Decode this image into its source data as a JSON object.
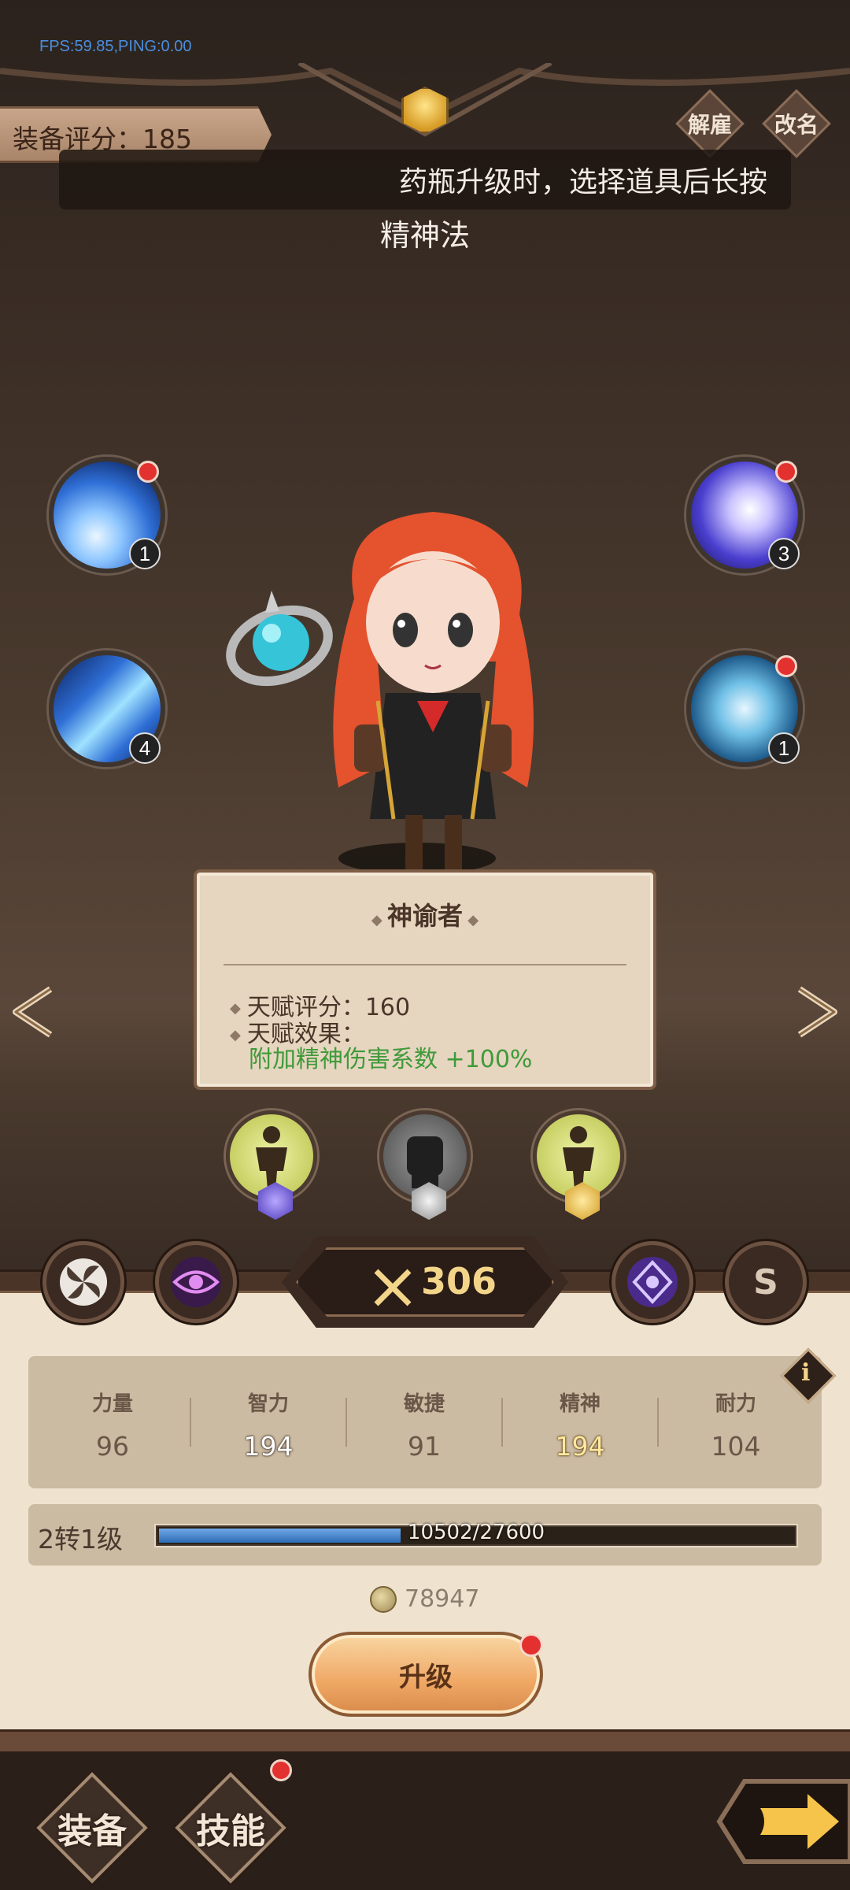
{
  "debug": {
    "fps_text": "FPS:59.85,PING:0.00"
  },
  "header": {
    "score_label": "装备评分：185",
    "dismiss_label": "解雇",
    "rename_label": "改名",
    "toast_text": "药瓶升级时，选择道具后长按",
    "class_name": "精神法"
  },
  "skills": {
    "top_left": {
      "count": "1",
      "has_alert": true,
      "icon": "lightning-skill-icon"
    },
    "mid_left": {
      "count": "4",
      "has_alert": false,
      "icon": "ice-shard-skill-icon"
    },
    "top_right": {
      "count": "3",
      "has_alert": true,
      "icon": "sprint-skill-icon"
    },
    "mid_right": {
      "count": "1",
      "has_alert": true,
      "icon": "frost-golem-skill-icon"
    }
  },
  "talent": {
    "title": "神谕者",
    "score_line": "天赋评分：160",
    "effect_label": "天赋效果：",
    "effect_text": "附加精神伤害系数 +100%"
  },
  "talent_nodes": [
    {
      "name": "talent-node-left",
      "gem": "purple"
    },
    {
      "name": "talent-node-center",
      "gem": "silver"
    },
    {
      "name": "talent-node-right",
      "gem": "gold"
    }
  ],
  "power": {
    "value": "306"
  },
  "side_buttons": {
    "s_label": "S"
  },
  "stats": [
    {
      "label": "力量",
      "value": "96",
      "style": "normal"
    },
    {
      "label": "智力",
      "value": "194",
      "style": "hi"
    },
    {
      "label": "敏捷",
      "value": "91",
      "style": "normal"
    },
    {
      "label": "精神",
      "value": "194",
      "style": "gold"
    },
    {
      "label": "耐力",
      "value": "104",
      "style": "normal"
    }
  ],
  "level": {
    "label": "2转1级",
    "xp_text": "10502/27600",
    "xp_current": 10502,
    "xp_max": 27600
  },
  "currency": {
    "value": "78947"
  },
  "upgrade": {
    "label": "升级",
    "has_alert": true
  },
  "bottom_nav": {
    "equip_label": "装备",
    "skills_label": "技能",
    "skills_alert": true
  },
  "colors": {
    "alert_red": "#e2312f",
    "effect_green": "#3f9a3a",
    "xp_blue": "#2d6cb5",
    "gold": "#f3d58a"
  }
}
